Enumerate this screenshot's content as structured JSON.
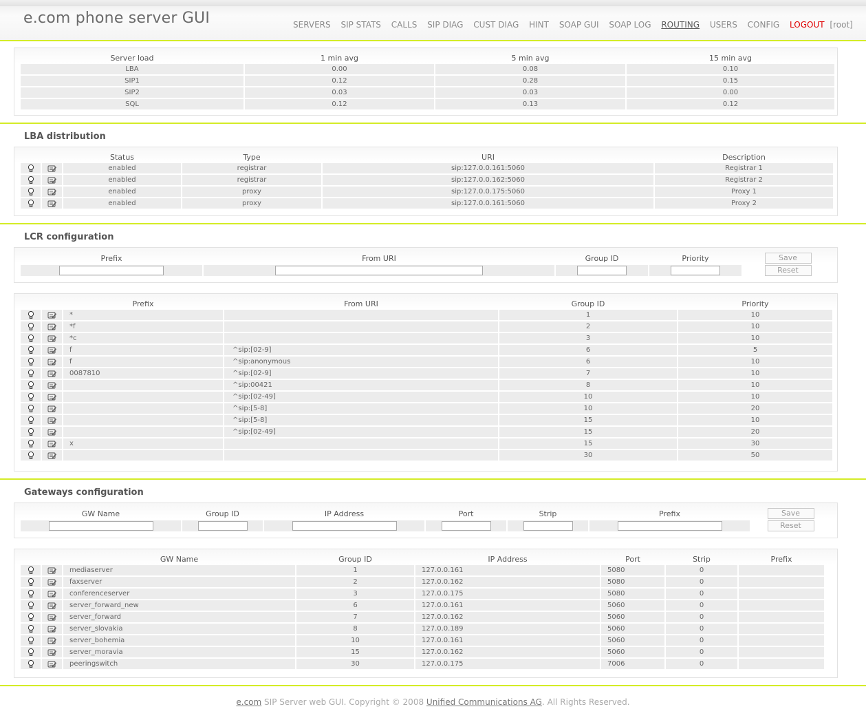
{
  "header": {
    "title": "e.com phone server GUI",
    "nav": [
      "SERVERS",
      "SIP STATS",
      "CALLS",
      "SIP DIAG",
      "CUST DIAG",
      "HINT",
      "SOAP GUI",
      "SOAP LOG",
      "ROUTING",
      "USERS",
      "CONFIG"
    ],
    "active": "ROUTING",
    "logout": "LOGOUT",
    "user": "[root]"
  },
  "server_load": {
    "headers": [
      "Server load",
      "1 min avg",
      "5 min avg",
      "15 min avg"
    ],
    "rows": [
      [
        "LBA",
        "0.00",
        "0.08",
        "0.10"
      ],
      [
        "SIP1",
        "0.12",
        "0.28",
        "0.15"
      ],
      [
        "SIP2",
        "0.03",
        "0.03",
        "0.00"
      ],
      [
        "SQL",
        "0.12",
        "0.13",
        "0.12"
      ]
    ]
  },
  "lba": {
    "title": "LBA distribution",
    "headers": [
      "Status",
      "Type",
      "URI",
      "Description"
    ],
    "rows": [
      [
        "enabled",
        "registrar",
        "sip:127.0.0.161:5060",
        "Registrar 1"
      ],
      [
        "enabled",
        "registrar",
        "sip:127.0.0.162:5060",
        "Registrar 2"
      ],
      [
        "enabled",
        "proxy",
        "sip:127.0.0.175:5060",
        "Proxy 1"
      ],
      [
        "enabled",
        "proxy",
        "sip:127.0.0.161:5060",
        "Proxy 2"
      ]
    ]
  },
  "lcr": {
    "title": "LCR configuration",
    "form_headers": [
      "Prefix",
      "From URI",
      "Group ID",
      "Priority"
    ],
    "save": "Save",
    "reset": "Reset",
    "headers": [
      "Prefix",
      "From URI",
      "Group ID",
      "Priority"
    ],
    "rows": [
      [
        "*",
        "",
        "1",
        "10"
      ],
      [
        "*f",
        "",
        "2",
        "10"
      ],
      [
        "*c",
        "",
        "3",
        "10"
      ],
      [
        "f",
        "^sip:[02-9]",
        "6",
        "5"
      ],
      [
        "f",
        "^sip:anonymous",
        "6",
        "10"
      ],
      [
        "0087810",
        "^sip:[02-9]",
        "7",
        "10"
      ],
      [
        "",
        "^sip:00421",
        "8",
        "10"
      ],
      [
        "",
        "^sip:[02-49]",
        "10",
        "10"
      ],
      [
        "",
        "^sip:[5-8]",
        "10",
        "20"
      ],
      [
        "",
        "^sip:[5-8]",
        "15",
        "10"
      ],
      [
        "",
        "^sip:[02-49]",
        "15",
        "20"
      ],
      [
        "x",
        "",
        "15",
        "30"
      ],
      [
        "",
        "",
        "30",
        "50"
      ]
    ]
  },
  "gateways": {
    "title": "Gateways configuration",
    "form_headers": [
      "GW Name",
      "Group ID",
      "IP Address",
      "Port",
      "Strip",
      "Prefix"
    ],
    "save": "Save",
    "reset": "Reset",
    "headers": [
      "GW Name",
      "Group ID",
      "IP Address",
      "Port",
      "Strip",
      "Prefix"
    ],
    "rows": [
      [
        "mediaserver",
        "1",
        "127.0.0.161",
        "5080",
        "0",
        ""
      ],
      [
        "faxserver",
        "2",
        "127.0.0.162",
        "5080",
        "0",
        ""
      ],
      [
        "conferenceserver",
        "3",
        "127.0.0.175",
        "5080",
        "0",
        ""
      ],
      [
        "server_forward_new",
        "6",
        "127.0.0.161",
        "5060",
        "0",
        ""
      ],
      [
        "server_forward",
        "7",
        "127.0.0.162",
        "5060",
        "0",
        ""
      ],
      [
        "server_slovakia",
        "8",
        "127.0.0.189",
        "5060",
        "0",
        ""
      ],
      [
        "server_bohemia",
        "10",
        "127.0.0.161",
        "5060",
        "0",
        ""
      ],
      [
        "server_moravia",
        "15",
        "127.0.0.162",
        "5060",
        "0",
        ""
      ],
      [
        "peeringswitch",
        "30",
        "127.0.0.175",
        "7006",
        "0",
        ""
      ]
    ]
  },
  "footer": {
    "brand": "e.com",
    "text1": " SIP Server web GUI. Copyright © 2008 ",
    "company": "Unified Communications AG",
    "text2": ". All Rights Reserved."
  },
  "colors": {
    "accent": "#d4ec27",
    "logout": "#e00000",
    "row": "#ececec"
  },
  "icons": {
    "status": "lightbulb-icon",
    "edit": "edit-icon"
  }
}
